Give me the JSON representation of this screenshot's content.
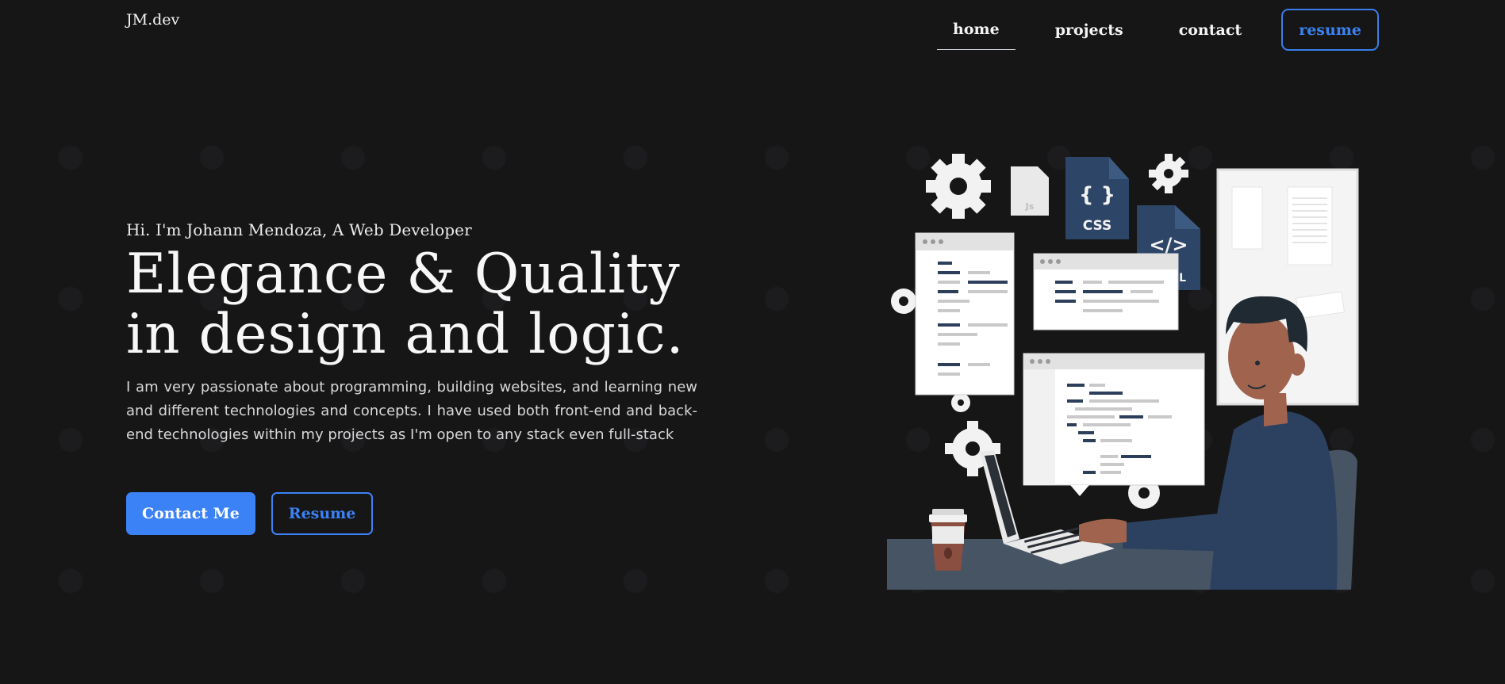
{
  "brand": "JM.dev",
  "nav": {
    "home": "home",
    "projects": "projects",
    "contact": "contact",
    "resume": "resume"
  },
  "hero": {
    "greeting": "Hi. I'm Johann Mendoza, A Web Developer",
    "headline_line1": "Elegance & Quality",
    "headline_line2": "in design and logic.",
    "description": "I am very passionate about programming, building websites, and learning new and different technologies and concepts. I have used both front-end and back-end technologies within my projects as I'm open to any stack even full-stack",
    "contact_button": "Contact Me",
    "resume_button": "Resume"
  },
  "illustration": {
    "file_css": "CSS",
    "file_css_braces": "{ }",
    "file_html_tag": "</>",
    "file_html_label": "HTML",
    "file_js": "Js"
  },
  "colors": {
    "background": "#161617",
    "accent": "#3b82f6",
    "text": "#f4f4f4",
    "navy": "#2c4160"
  },
  "icons": [
    "gear-icon",
    "file-icon",
    "laptop-icon",
    "coffee-cup-icon",
    "developer-figure"
  ]
}
